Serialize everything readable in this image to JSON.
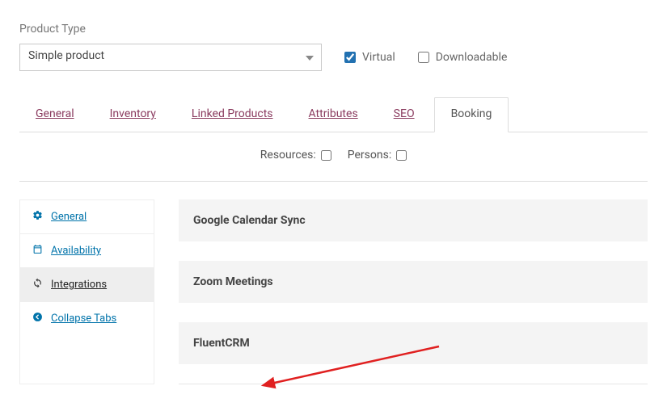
{
  "product_type": {
    "label": "Product Type",
    "selected": "Simple product"
  },
  "flags": {
    "virtual": {
      "label": "Virtual",
      "checked": true
    },
    "downloadable": {
      "label": "Downloadable",
      "checked": false
    }
  },
  "tabs": [
    "General",
    "Inventory",
    "Linked Products",
    "Attributes",
    "SEO",
    "Booking"
  ],
  "active_tab": "Booking",
  "booking_options": {
    "resources": {
      "label": "Resources:",
      "checked": false
    },
    "persons": {
      "label": "Persons:",
      "checked": false
    }
  },
  "sidebar": {
    "items": [
      {
        "label": "General",
        "icon": "gear-icon"
      },
      {
        "label": "Availability",
        "icon": "calendar-icon"
      },
      {
        "label": "Integrations",
        "icon": "sync-icon"
      },
      {
        "label": "Collapse Tabs",
        "icon": "collapse-icon"
      }
    ],
    "active": "Integrations"
  },
  "integrations": {
    "items": [
      "Google Calendar Sync",
      "Zoom Meetings",
      "FluentCRM"
    ]
  }
}
